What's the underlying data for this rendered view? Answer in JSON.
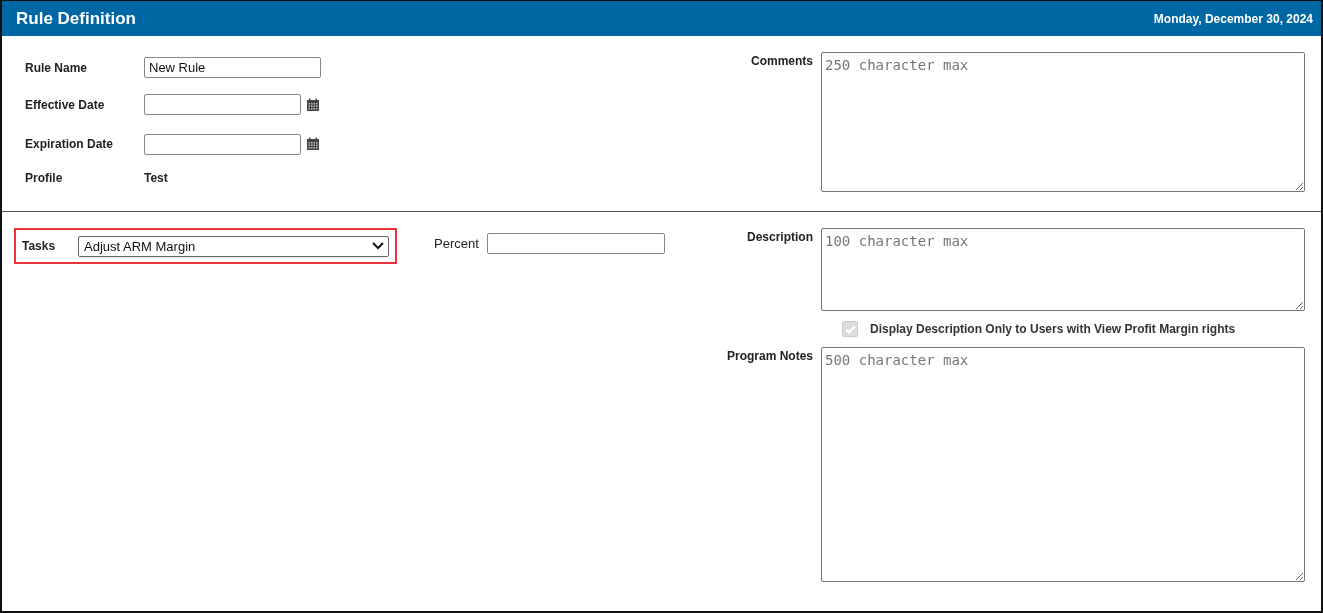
{
  "header": {
    "title": "Rule Definition",
    "date": "Monday, December 30, 2024"
  },
  "rule_fields": [
    {
      "label": "Rule Name",
      "kind": "text",
      "value": "New Rule"
    },
    {
      "label": "Effective Date",
      "kind": "date"
    },
    {
      "label": "Expiration Date",
      "kind": "date"
    },
    {
      "label": "Profile",
      "kind": "static",
      "value": "Test"
    }
  ],
  "comments": {
    "label": "Comments",
    "placeholder": "250 character max"
  },
  "tasks": {
    "label": "Tasks",
    "value": "Adjust ARM Margin",
    "highlighted": true
  },
  "percent": {
    "label": "Percent"
  },
  "description": {
    "label": "Description",
    "placeholder": "100 character max"
  },
  "display_option": {
    "label": "Display Description Only to Users with View Profit Margin rights",
    "checked": true,
    "disabled": true
  },
  "program_notes": {
    "label": "Program Notes",
    "placeholder": "500 character max"
  }
}
